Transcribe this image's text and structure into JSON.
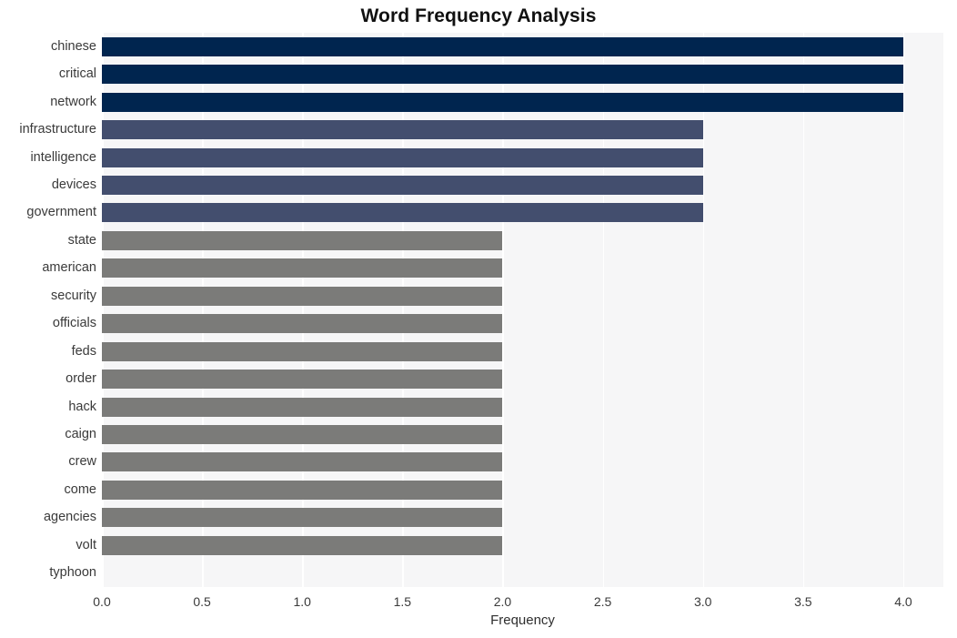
{
  "chart_data": {
    "type": "bar",
    "orientation": "horizontal",
    "title": "Word Frequency Analysis",
    "xlabel": "Frequency",
    "ylabel": "",
    "xlim": [
      0.0,
      4.2
    ],
    "xticks": [
      "0.0",
      "0.5",
      "1.0",
      "1.5",
      "2.0",
      "2.5",
      "3.0",
      "3.5",
      "4.0"
    ],
    "xtick_values": [
      0.0,
      0.5,
      1.0,
      1.5,
      2.0,
      2.5,
      3.0,
      3.5,
      4.0
    ],
    "grid": "vertical-white-on-light-gray",
    "legend": "none",
    "categories": [
      "chinese",
      "critical",
      "network",
      "infrastructure",
      "intelligence",
      "devices",
      "government",
      "state",
      "american",
      "security",
      "officials",
      "feds",
      "order",
      "hack",
      "caign",
      "crew",
      "come",
      "agencies",
      "volt",
      "typhoon"
    ],
    "values": [
      4,
      4,
      4,
      3,
      3,
      3,
      3,
      2,
      2,
      2,
      2,
      2,
      2,
      2,
      2,
      2,
      2,
      2,
      2
    ],
    "bar_colors": [
      "#00254f",
      "#00254f",
      "#00254f",
      "#434e6e",
      "#434e6e",
      "#434e6e",
      "#434e6e",
      "#7b7b79",
      "#7b7b79",
      "#7b7b79",
      "#7b7b79",
      "#7b7b79",
      "#7b7b79",
      "#7b7b79",
      "#7b7b79",
      "#7b7b79",
      "#7b7b79",
      "#7b7b79",
      "#7b7b79"
    ]
  },
  "colors": {
    "plot_background": "#f6f6f7",
    "figure_background": "#ffffff",
    "gridline": "#ffffff",
    "navy": "#00254f",
    "slate": "#434e6e",
    "gray": "#7b7b79",
    "tick_text": "#3a3a3a",
    "title_text": "#111111"
  }
}
